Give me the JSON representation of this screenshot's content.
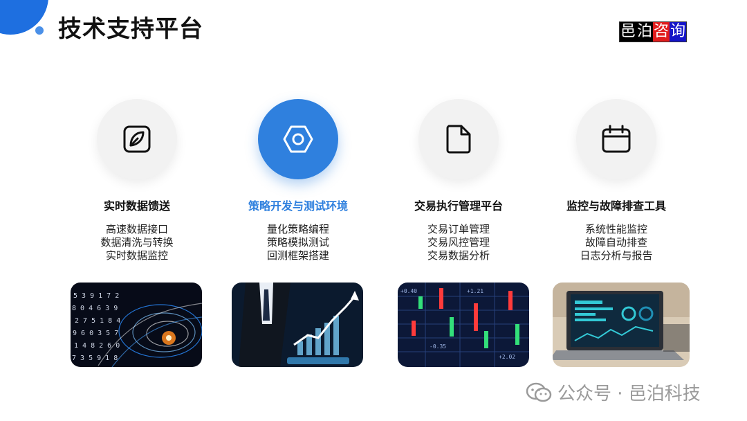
{
  "header": {
    "title": "技术支持平台",
    "brand": [
      "邑",
      "泊",
      "咨",
      "询"
    ]
  },
  "columns": [
    {
      "icon": "leaf-square-icon",
      "title": "实时数据馈送",
      "items": [
        "高速数据接口",
        "数据清洗与转换",
        "实时数据监控"
      ],
      "image": "digital-data-tunnel-image"
    },
    {
      "icon": "hexagon-nut-icon",
      "title": "策略开发与测试环境",
      "items": [
        "量化策略编程",
        "策略模拟测试",
        "回测框架搭建"
      ],
      "image": "business-chart-growth-image"
    },
    {
      "icon": "document-icon",
      "title": "交易执行管理平台",
      "items": [
        "交易订单管理",
        "交易风控管理",
        "交易数据分析"
      ],
      "image": "stock-ticker-board-image"
    },
    {
      "icon": "calendar-icon",
      "title": "监控与故障排查工具",
      "items": [
        "系统性能监控",
        "故障自动排查",
        "日志分析与报告"
      ],
      "image": "laptop-dashboard-image"
    }
  ],
  "watermark": {
    "text": "公众号 · 邑泊科技"
  },
  "colors": {
    "accent": "#2f80de",
    "brand_red": "#e11d1d",
    "brand_blue": "#1414c8"
  }
}
